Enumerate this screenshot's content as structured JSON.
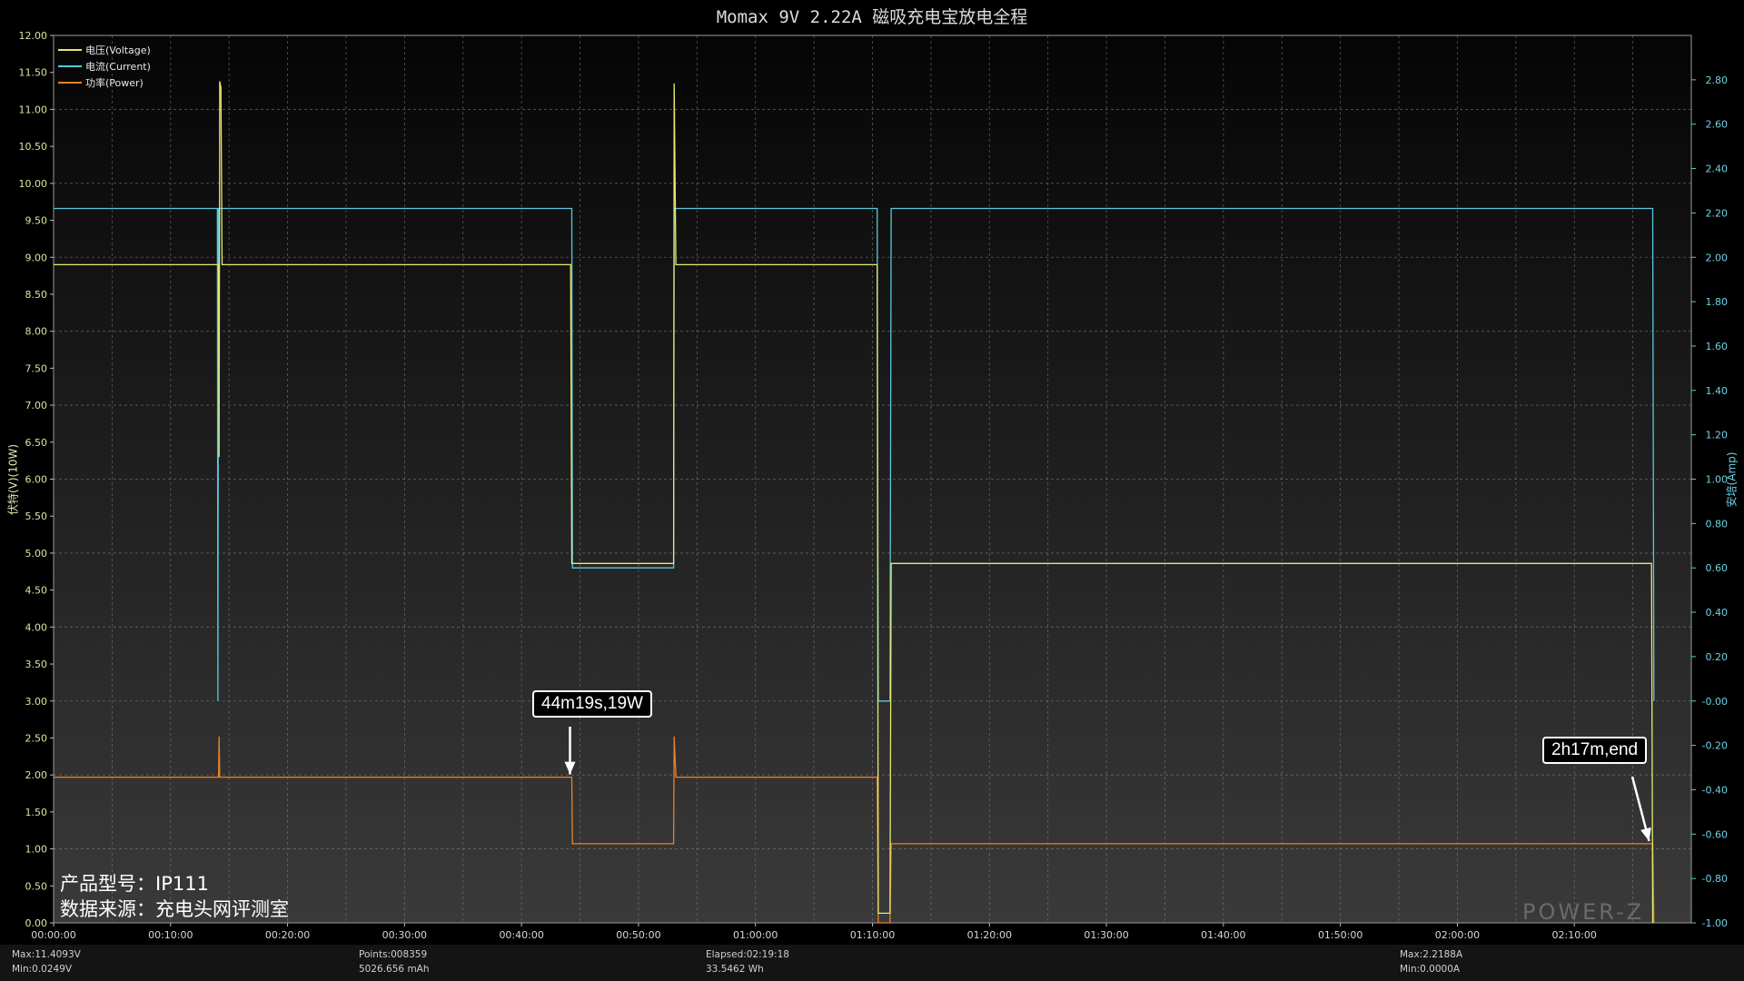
{
  "chart_data": {
    "type": "line",
    "title": "Momax 9V 2.22A 磁吸充电宝放电全程",
    "ylabel_left": "伏特(V)(10W)",
    "ylabel_right": "安培(Amp)",
    "x_unit": "minutes",
    "xlim": [
      0,
      140
    ],
    "ylim_left": [
      0,
      12
    ],
    "ylim_right": [
      -1.0,
      3.0
    ],
    "grid": true,
    "legend_position": "top-left",
    "x_ticks": [
      {
        "value": 0,
        "label": "00:00:00"
      },
      {
        "value": 10,
        "label": "00:10:00"
      },
      {
        "value": 20,
        "label": "00:20:00"
      },
      {
        "value": 30,
        "label": "00:30:00"
      },
      {
        "value": 40,
        "label": "00:40:00"
      },
      {
        "value": 50,
        "label": "00:50:00"
      },
      {
        "value": 60,
        "label": "01:00:00"
      },
      {
        "value": 70,
        "label": "01:10:00"
      },
      {
        "value": 80,
        "label": "01:20:00"
      },
      {
        "value": 90,
        "label": "01:30:00"
      },
      {
        "value": 100,
        "label": "01:40:00"
      },
      {
        "value": 110,
        "label": "01:50:00"
      },
      {
        "value": 120,
        "label": "02:00:00"
      },
      {
        "value": 130,
        "label": "02:10:00"
      }
    ],
    "y_left_ticks": [
      "0.00",
      "0.50",
      "1.00",
      "1.50",
      "2.00",
      "2.50",
      "3.00",
      "3.50",
      "4.00",
      "4.50",
      "5.00",
      "5.50",
      "6.00",
      "6.50",
      "7.00",
      "7.50",
      "8.00",
      "8.50",
      "9.00",
      "9.50",
      "10.00",
      "10.50",
      "11.00",
      "11.50",
      "12.00"
    ],
    "y_right_ticks": [
      "-1.00",
      "-0.80",
      "-0.60",
      "-0.40",
      "-0.20",
      "-0.00",
      "0.20",
      "0.40",
      "0.60",
      "0.80",
      "1.00",
      "1.20",
      "1.40",
      "1.60",
      "1.80",
      "2.00",
      "2.20",
      "2.40",
      "2.60",
      "2.80"
    ],
    "series": [
      {
        "name": "电压(Voltage)",
        "axis": "left",
        "color": "#e8e870",
        "points": [
          [
            0,
            8.9
          ],
          [
            14.1,
            8.9
          ],
          [
            14.15,
            6.3
          ],
          [
            14.2,
            11.38
          ],
          [
            14.3,
            11.3
          ],
          [
            14.4,
            8.9
          ],
          [
            44.2,
            8.9
          ],
          [
            44.3,
            4.86
          ],
          [
            53,
            4.86
          ],
          [
            53.05,
            11.35
          ],
          [
            53.2,
            8.9
          ],
          [
            70.4,
            8.9
          ],
          [
            70.5,
            0.13
          ],
          [
            71.5,
            0.13
          ],
          [
            71.6,
            4.86
          ],
          [
            136.6,
            4.86
          ],
          [
            136.7,
            0.0
          ]
        ]
      },
      {
        "name": "电流(Current)",
        "axis": "right",
        "color": "#5bc8dc",
        "points": [
          [
            0,
            2.22
          ],
          [
            14.0,
            2.22
          ],
          [
            14.05,
            0.0
          ],
          [
            14.1,
            2.22
          ],
          [
            44.3,
            2.22
          ],
          [
            44.35,
            0.6
          ],
          [
            53,
            0.6
          ],
          [
            53.05,
            2.22
          ],
          [
            70.4,
            2.22
          ],
          [
            70.5,
            0.0
          ],
          [
            71.5,
            0.0
          ],
          [
            71.6,
            2.22
          ],
          [
            136.7,
            2.22
          ],
          [
            136.8,
            0.0
          ]
        ]
      },
      {
        "name": "功率(Power)",
        "axis": "left",
        "scale": "10W",
        "color": "#e8822a",
        "points": [
          [
            0,
            1.97
          ],
          [
            14.1,
            1.97
          ],
          [
            14.15,
            2.52
          ],
          [
            14.2,
            1.97
          ],
          [
            44.3,
            1.97
          ],
          [
            44.35,
            1.07
          ],
          [
            53,
            1.07
          ],
          [
            53.05,
            2.52
          ],
          [
            53.2,
            1.97
          ],
          [
            70.4,
            1.97
          ],
          [
            70.5,
            0.0
          ],
          [
            71.5,
            0.0
          ],
          [
            71.6,
            1.07
          ],
          [
            136.7,
            1.07
          ],
          [
            136.8,
            0.0
          ]
        ]
      }
    ],
    "annotations": [
      {
        "text": "44m19s,19W",
        "x": 44.3,
        "y": 1.97
      },
      {
        "text": "2h17m,end",
        "x": 136.7,
        "y": 1.07
      }
    ]
  },
  "overlay": {
    "model_line": "产品型号：IP111",
    "source_line": "数据来源：充电头网评测室",
    "watermark": "POWER-Z"
  },
  "stats": {
    "max_voltage": "Max:11.4093V",
    "min_voltage": "Min:0.0249V",
    "points": "Points:008359",
    "capacity": "5026.656 mAh",
    "elapsed": "Elapsed:02:19:18",
    "energy": "33.5462 Wh",
    "max_current": "Max:2.2188A",
    "min_current": "Min:0.0000A"
  }
}
